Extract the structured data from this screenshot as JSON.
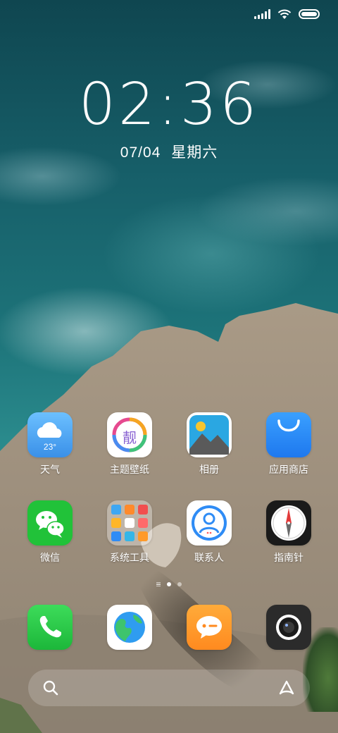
{
  "status_bar": {
    "icons": [
      "signal-icon",
      "wifi-icon",
      "battery-icon"
    ],
    "battery_level": 1.0
  },
  "lock": {
    "time": "02:36",
    "date": "07/04",
    "weekday": "星期六"
  },
  "apps": [
    {
      "label": "天气",
      "icon": "weather-icon",
      "temp": "23°",
      "color": "#4aa3ef"
    },
    {
      "label": "主题壁纸",
      "icon": "themes-icon",
      "icon_text": "靓",
      "color": "#ffffff"
    },
    {
      "label": "相册",
      "icon": "gallery-icon",
      "color": "#29a8e0"
    },
    {
      "label": "应用商店",
      "icon": "app-store-icon",
      "color": "#2e8cf6"
    },
    {
      "label": "微信",
      "icon": "wechat-icon",
      "color": "#1fc43a"
    },
    {
      "label": "系统工具",
      "icon": "folder-icon",
      "color": "rgba(255,255,255,0.35)"
    },
    {
      "label": "联系人",
      "icon": "contacts-icon",
      "color": "#2f8cf5"
    },
    {
      "label": "指南针",
      "icon": "compass-icon",
      "color": "#1a1a1a"
    }
  ],
  "dock": [
    {
      "icon": "phone-icon",
      "color": "#2ecc4a"
    },
    {
      "icon": "browser-icon",
      "color": "#ffffff"
    },
    {
      "icon": "messages-icon",
      "color": "#ff9a2a"
    },
    {
      "icon": "camera-icon",
      "color": "#2b2b2b"
    }
  ],
  "pages": {
    "count": 2,
    "current": 1
  },
  "search": {
    "icons": [
      "search-icon",
      "assistant-icon"
    ]
  }
}
